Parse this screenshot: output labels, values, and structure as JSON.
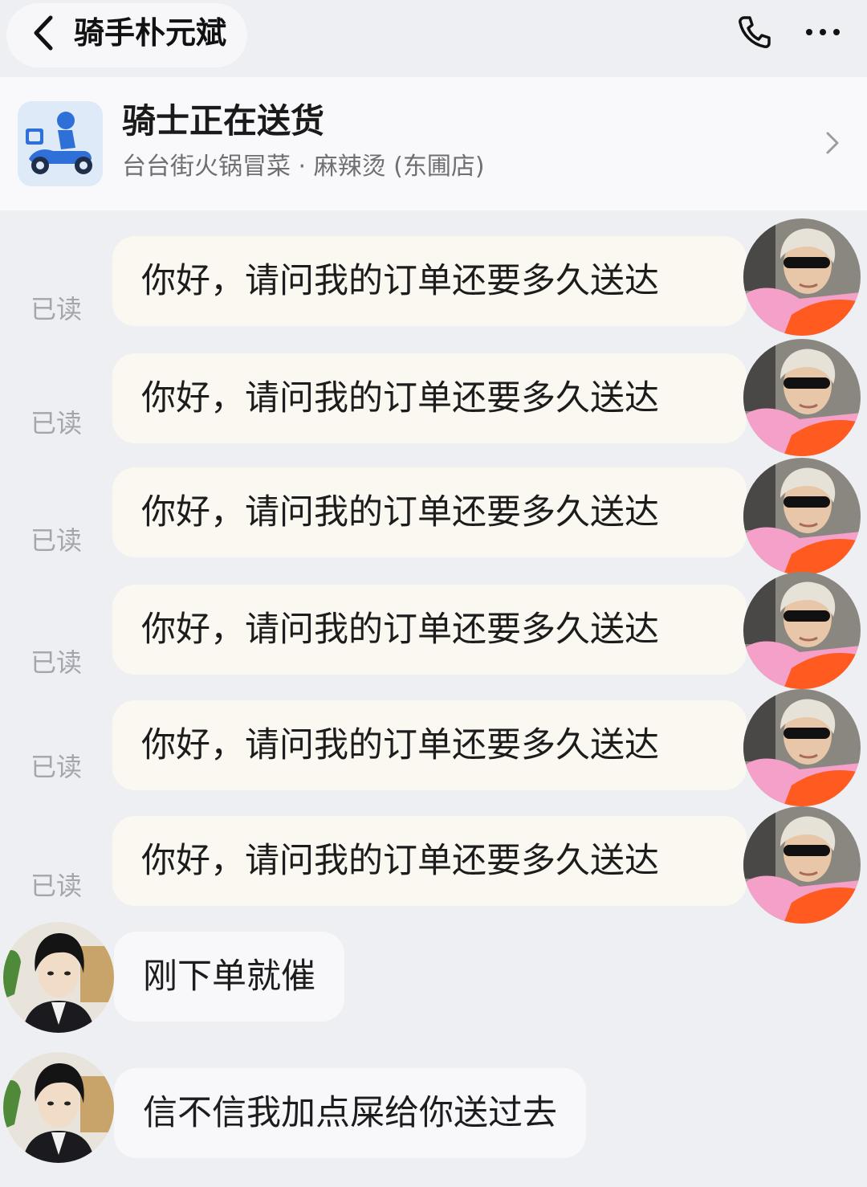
{
  "header": {
    "title": "骑手朴元斌",
    "back_icon": "chevron-left-icon",
    "phone_icon": "phone-icon",
    "more_icon": "more-horizontal-icon"
  },
  "order": {
    "status": "骑士正在送货",
    "store": "台台街火锅冒菜 · 麻辣烫 (东圃店)",
    "icon": "delivery-rider-icon",
    "chevron": "chevron-right-icon"
  },
  "messages_sent": [
    {
      "read_label": "已读",
      "text": "你好，请问我的订单还要多久送达"
    },
    {
      "read_label": "已读",
      "text": "你好，请问我的订单还要多久送达"
    },
    {
      "read_label": "已读",
      "text": "你好，请问我的订单还要多久送达"
    },
    {
      "read_label": "已读",
      "text": "你好，请问我的订单还要多久送达"
    },
    {
      "read_label": "已读",
      "text": "你好，请问我的订单还要多久送达"
    },
    {
      "read_label": "已读",
      "text": "你好，请问我的订单还要多久送达"
    }
  ],
  "messages_received": [
    {
      "text": "刚下单就催"
    },
    {
      "text": "信不信我加点屎给你送过去"
    }
  ],
  "colors": {
    "background": "#eeeff3",
    "bubble_sent": "#faf8f1",
    "bubble_received": "#f8f8fa",
    "read_text": "#a4a6ad",
    "rider_blue": "#2f6fd8"
  }
}
